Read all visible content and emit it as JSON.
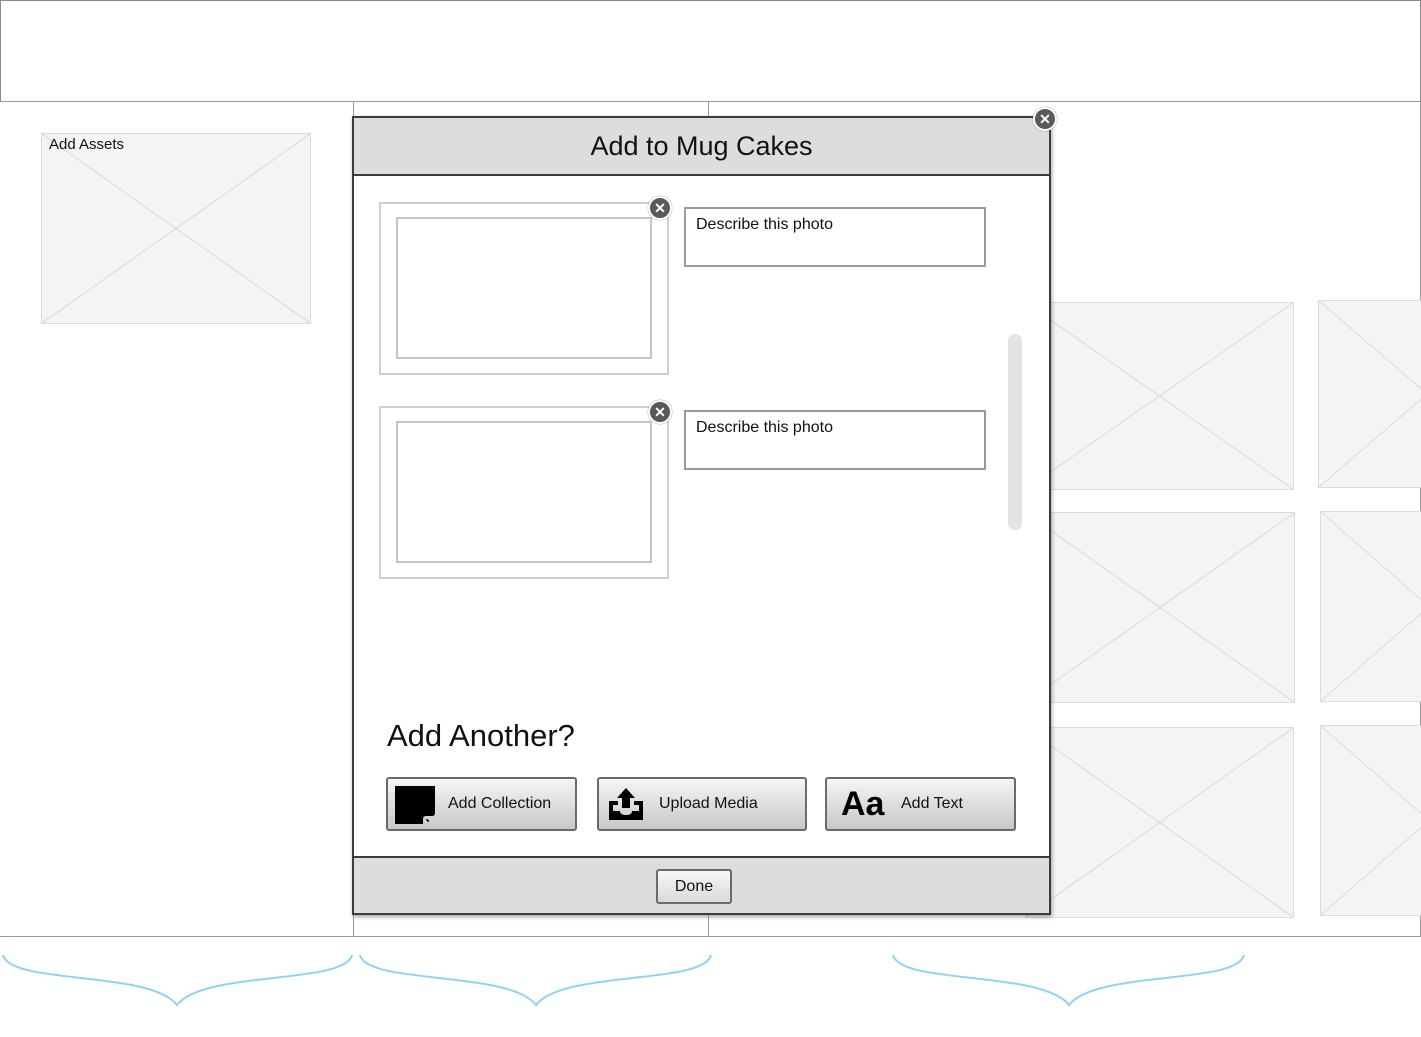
{
  "left_panel": {
    "placeholder_label": "Add Assets"
  },
  "dialog": {
    "title": "Add to Mug Cakes",
    "photos": [
      {
        "description": "Describe this photo"
      },
      {
        "description": "Describe this photo"
      }
    ],
    "add_another_heading": "Add Another?",
    "buttons": {
      "add_collection": "Add Collection",
      "upload_media": "Upload Media",
      "add_text": "Add Text",
      "add_text_icon_glyph": "Aa"
    },
    "done_label": "Done"
  },
  "icons": {
    "close": "close-icon",
    "collection": "collection-icon",
    "upload": "upload-icon",
    "text": "text-icon"
  },
  "colors": {
    "brace": "#8fd3f4",
    "dialog_header": "#dddddd",
    "placeholder": "#f4f4f4",
    "close_badge": "#5a5a5a"
  }
}
